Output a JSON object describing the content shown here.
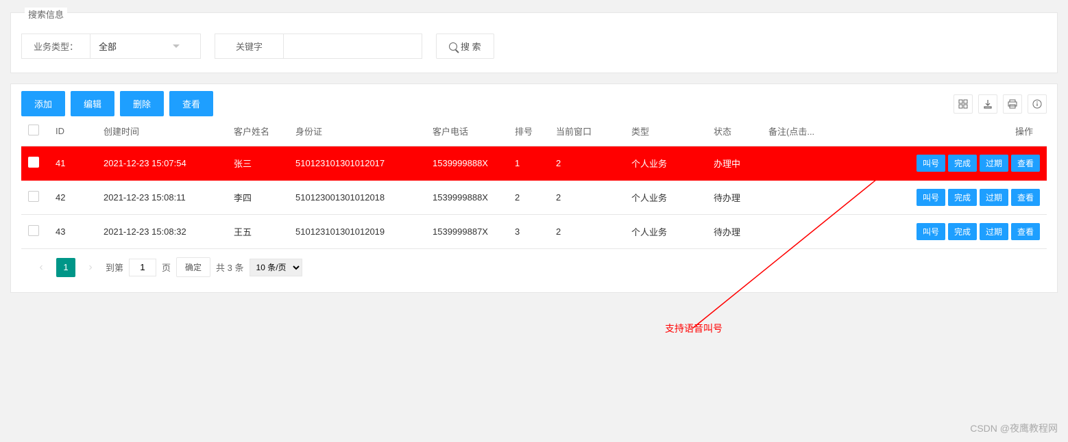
{
  "search": {
    "legend": "搜索信息",
    "bizTypeLabel": "业务类型：",
    "bizTypeValue": "全部",
    "keywordLabel": "关键字",
    "keywordValue": "",
    "searchBtn": "搜 索"
  },
  "toolbar": {
    "add": "添加",
    "edit": "编辑",
    "delete": "删除",
    "view": "查看"
  },
  "table": {
    "headers": {
      "id": "ID",
      "createdAt": "创建时间",
      "customerName": "客户姓名",
      "idCard": "身份证",
      "customerPhone": "客户电话",
      "queueNo": "排号",
      "currentWindow": "当前窗口",
      "type": "类型",
      "status": "状态",
      "remark": "备注(点击...",
      "action": "操作"
    },
    "rows": [
      {
        "id": "41",
        "createdAt": "2021-12-23 15:07:54",
        "customerName": "张三",
        "idCard": "510123101301012017",
        "customerPhone": "1539999888X",
        "queueNo": "1",
        "currentWindow": "2",
        "type": "个人业务",
        "status": "办理中",
        "remark": "",
        "highlight": true
      },
      {
        "id": "42",
        "createdAt": "2021-12-23 15:08:11",
        "customerName": "李四",
        "idCard": "510123001301012018",
        "customerPhone": "1539999888X",
        "queueNo": "2",
        "currentWindow": "2",
        "type": "个人业务",
        "status": "待办理",
        "remark": "",
        "highlight": false
      },
      {
        "id": "43",
        "createdAt": "2021-12-23 15:08:32",
        "customerName": "王五",
        "idCard": "510123101301012019",
        "customerPhone": "1539999887X",
        "queueNo": "3",
        "currentWindow": "2",
        "type": "个人业务",
        "status": "待办理",
        "remark": "",
        "highlight": false
      }
    ],
    "actions": {
      "call": "叫号",
      "complete": "完成",
      "expire": "过期",
      "view": "查看"
    }
  },
  "pagination": {
    "gotoLabel": "到第",
    "pageUnit": "页",
    "currentPage": "1",
    "gotoInput": "1",
    "confirm": "确定",
    "totalText": "共 3 条",
    "perPage": "10 条/页"
  },
  "annotation": {
    "text": "支持语音叫号"
  },
  "watermark": "CSDN @夜鹰教程网"
}
